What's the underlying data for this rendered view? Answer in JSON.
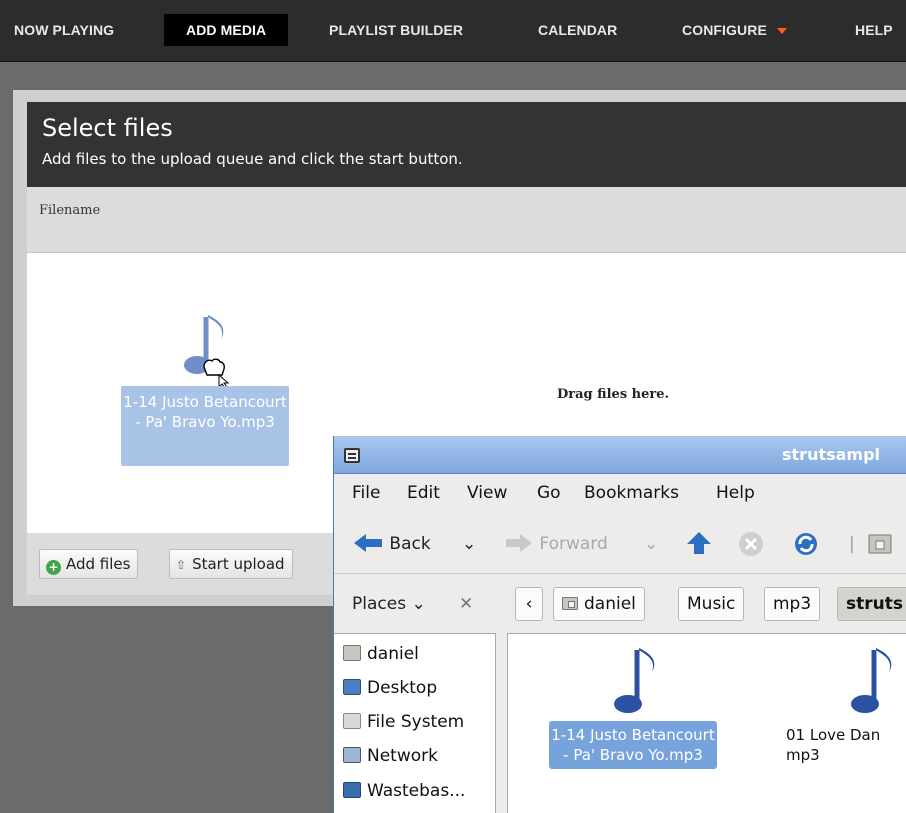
{
  "nav": {
    "items": [
      "NOW PLAYING",
      "ADD MEDIA",
      "PLAYLIST BUILDER",
      "CALENDAR",
      "CONFIGURE",
      "HELP"
    ],
    "active": "ADD MEDIA",
    "accent": "#ff5d1a"
  },
  "uploader": {
    "title": "Select files",
    "subtitle": "Add files to the upload queue and click the start button.",
    "column_filename": "Filename",
    "drop_hint": "Drag files here.",
    "add_files_label": "Add files",
    "start_upload_label": "Start upload",
    "dragged_file": "1-14 Justo Betancourt - Pa' Bravo Yo.mp3"
  },
  "file_manager": {
    "title": "strutsampl",
    "menu": [
      "File",
      "Edit",
      "View",
      "Go",
      "Bookmarks",
      "Help"
    ],
    "toolbar": {
      "back": "Back",
      "forward": "Forward"
    },
    "places_label": "Places",
    "breadcrumbs": [
      "daniel",
      "Music",
      "mp3",
      "struts"
    ],
    "places": [
      "daniel",
      "Desktop",
      "File System",
      "Network",
      "Wastebas..."
    ],
    "files": [
      {
        "name": "1-14 Justo Betancourt - Pa' Bravo Yo.mp3",
        "selected": true
      },
      {
        "name": "01 Love Dan mp3",
        "selected": false
      }
    ],
    "icon_color": "#2a52a0"
  }
}
